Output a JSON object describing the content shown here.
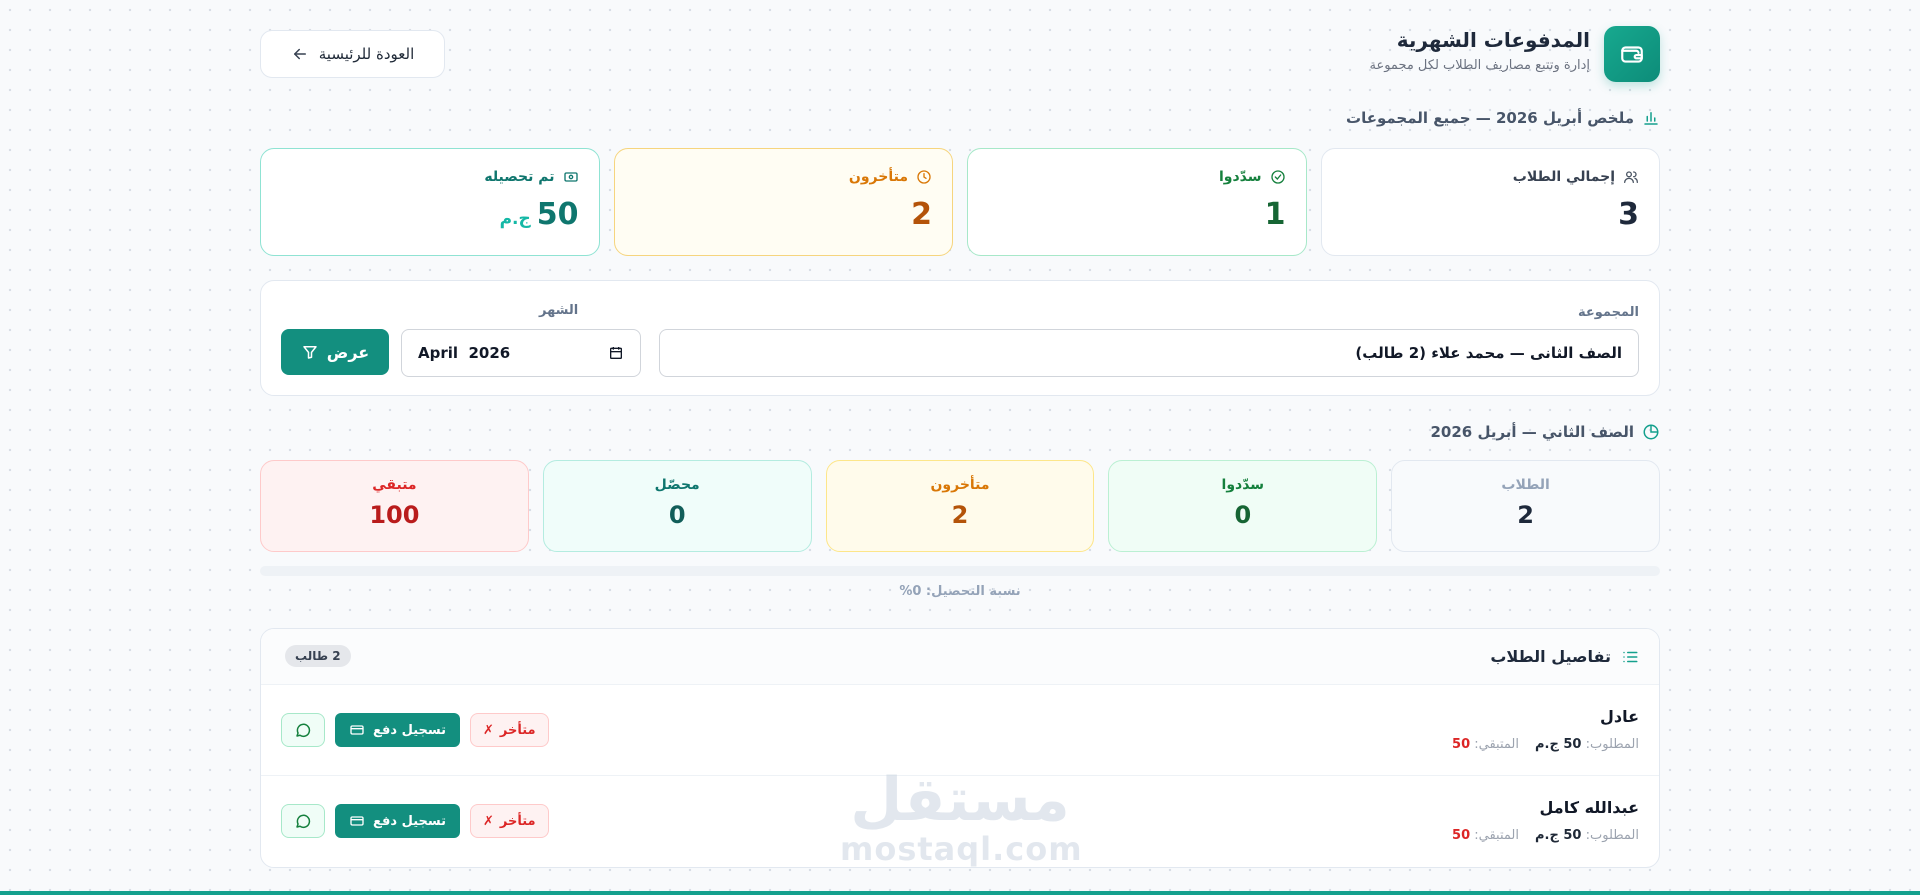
{
  "header": {
    "title": "المدفوعات الشهرية",
    "subtitle": "إدارة وتتبع مصاريف الطلاب لكل مجموعة",
    "back_label": "العودة للرئيسية"
  },
  "summary": {
    "heading": "ملخص أبريل 2026 — جميع المجموعات",
    "cards": [
      {
        "label": "إجمالي الطلاب",
        "value": "3",
        "icon": "users-icon"
      },
      {
        "label": "سدّدوا",
        "value": "1",
        "icon": "check-circle-icon"
      },
      {
        "label": "متأخرون",
        "value": "2",
        "icon": "clock-icon"
      },
      {
        "label": "تم تحصيله",
        "value": "50",
        "unit": "ج.م",
        "icon": "cash-icon"
      }
    ]
  },
  "filter": {
    "group_label": "المجموعة",
    "group_value": "الصف الثانى — محمد علاء (2 طالب)",
    "month_label": "الشهر",
    "month_value": "April  2026",
    "show_label": "عرض"
  },
  "group": {
    "heading": "الصف الثاني — أبريل 2026",
    "stats": [
      {
        "label": "الطلاب",
        "value": "2"
      },
      {
        "label": "سدّدوا",
        "value": "0"
      },
      {
        "label": "متأخرون",
        "value": "2"
      },
      {
        "label": "محصّل",
        "value": "0"
      },
      {
        "label": "متبقي",
        "value": "100"
      }
    ],
    "progress_percent": 0,
    "progress_text": "نسبة التحصيل: 0%"
  },
  "students": {
    "title": "تفاصيل الطلاب",
    "count": "2 طالب",
    "required_label": "المطلوب:",
    "remaining_label": "المتبقي:",
    "pay_label": "تسجيل دفع",
    "late_label": "متأخر",
    "rows": [
      {
        "name": "عادل",
        "required": "50 ج.م",
        "remaining": "50"
      },
      {
        "name": "عبدالله كامل",
        "required": "50 ج.م",
        "remaining": "50"
      }
    ]
  },
  "colors": {
    "accent": "#138f7f",
    "green": "#15803d",
    "amber": "#d97706",
    "red": "#dc2626"
  },
  "watermark": {
    "arabic": "مستقل",
    "latin": "mostaql.com"
  }
}
